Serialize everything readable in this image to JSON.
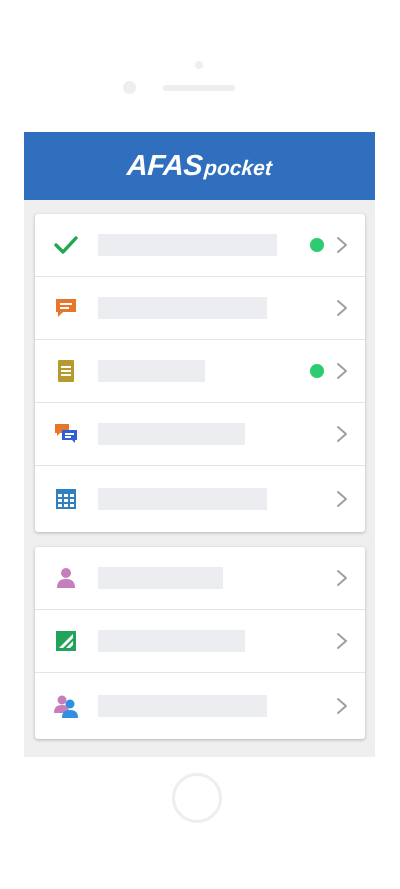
{
  "app": {
    "logo_main": "AFAS",
    "logo_sub": "pocket"
  },
  "colors": {
    "header": "#2f6fbd",
    "status_active": "#2ecc71",
    "placeholder": "#ebedf0"
  },
  "group1": {
    "items": [
      {
        "icon": "checkmark-icon",
        "label": "",
        "has_status": true
      },
      {
        "icon": "chat-bubble-icon",
        "label": "",
        "has_status": false
      },
      {
        "icon": "document-icon",
        "label": "",
        "has_status": true
      },
      {
        "icon": "conversation-icon",
        "label": "",
        "has_status": false
      },
      {
        "icon": "table-icon",
        "label": "",
        "has_status": false
      }
    ]
  },
  "group2": {
    "items": [
      {
        "icon": "person-icon",
        "label": "",
        "has_status": false
      },
      {
        "icon": "report-icon",
        "label": "",
        "has_status": false
      },
      {
        "icon": "people-icon",
        "label": "",
        "has_status": false
      }
    ]
  }
}
